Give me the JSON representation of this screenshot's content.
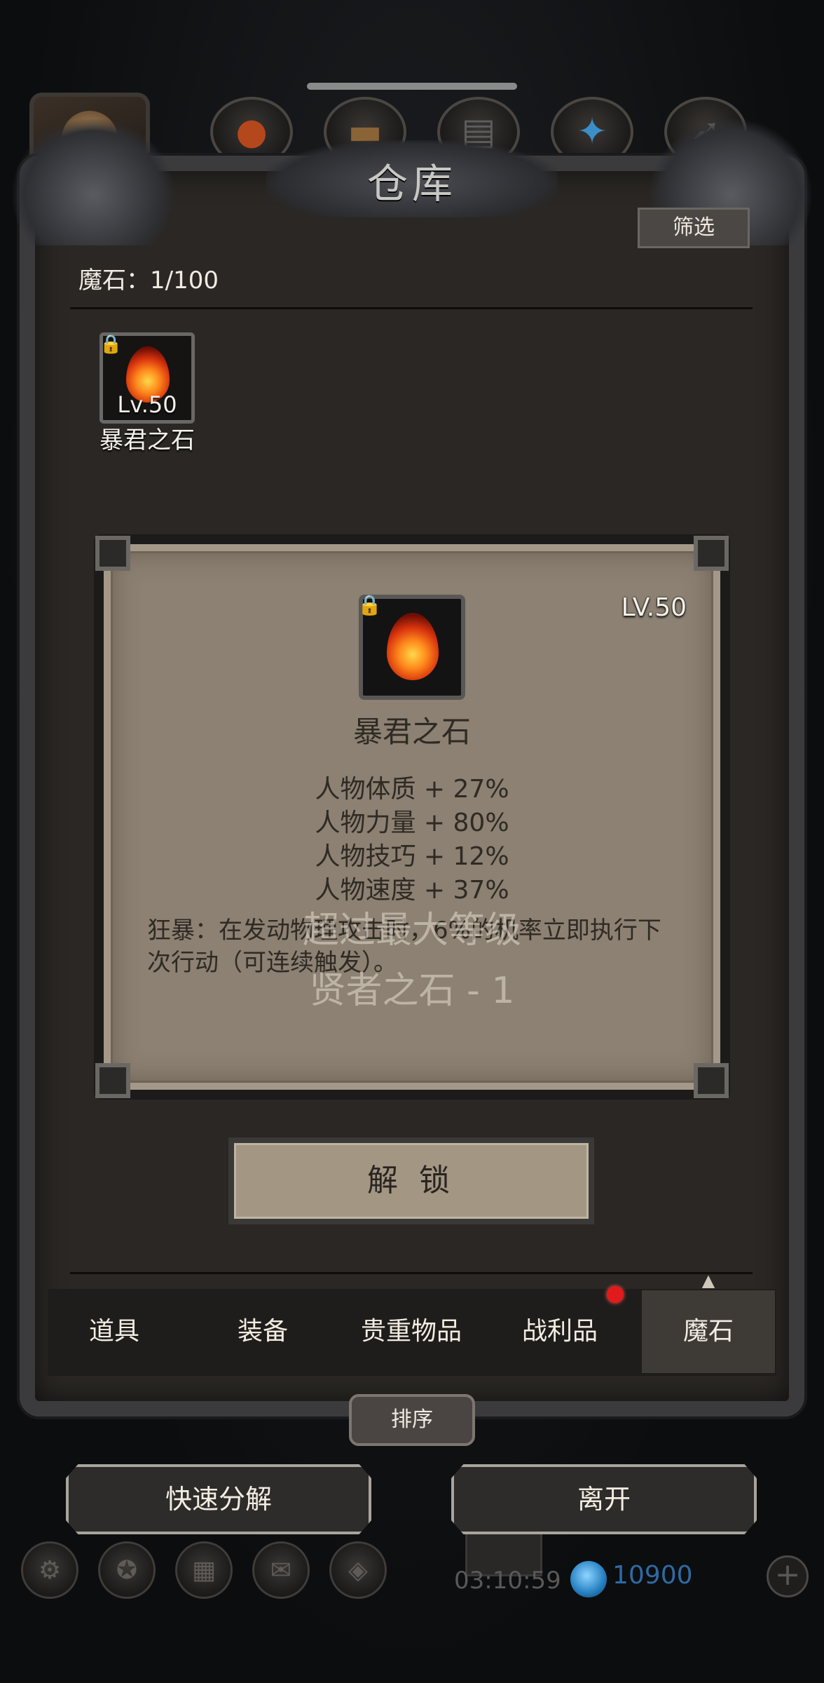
{
  "window": {
    "title": "仓库"
  },
  "top_icons": [
    "portrait",
    "red-bag-icon",
    "wood-icon",
    "scroll-icon",
    "feather-icon",
    "arrow-icon"
  ],
  "header": {
    "filter_label": "筛选",
    "count_label": "魔石：1/100"
  },
  "inventory": {
    "items": [
      {
        "level": "Lv.50",
        "name": "暴君之石",
        "locked": true,
        "icon": "flame-stone-icon"
      }
    ]
  },
  "detail": {
    "level": "LV.50",
    "name": "暴君之石",
    "stats": [
      "人物体质 + 27%",
      "人物力量 + 80%",
      "人物技巧 + 12%",
      "人物速度 + 37%"
    ],
    "description": "狂暴：在发动物理攻击时，6%的机率立即执行下次行动（可连续触发）。",
    "overlay_line1": "超过最大等级",
    "overlay_line2": "贤者之石 - 1",
    "unlock_label": "解 锁"
  },
  "tabs": [
    {
      "label": "道具",
      "active": false
    },
    {
      "label": "装备",
      "active": false
    },
    {
      "label": "贵重物品",
      "active": false
    },
    {
      "label": "战利品",
      "active": false,
      "badge": true
    },
    {
      "label": "魔石",
      "active": true
    }
  ],
  "footer": {
    "sort_label": "排序",
    "quick_decompose_label": "快速分解",
    "leave_label": "离开",
    "timer": "03:10:59",
    "currency_amount": "10900"
  },
  "colors": {
    "badge": "#e11b1b",
    "currency": "#2e6aa4",
    "card_bg": "#8c8172"
  }
}
